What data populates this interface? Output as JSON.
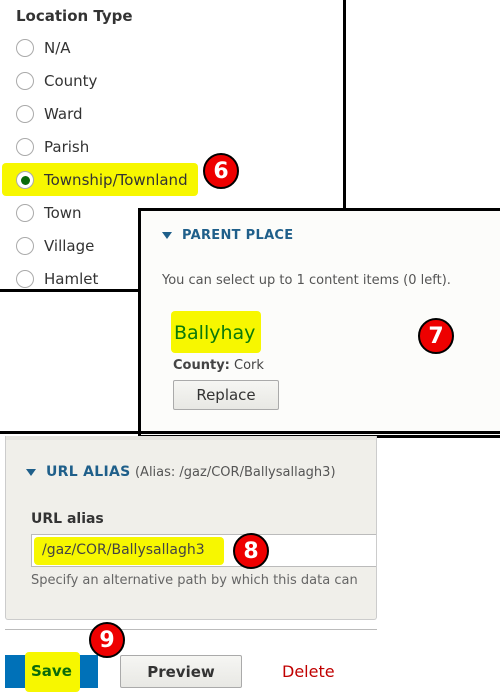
{
  "location_type": {
    "label": "Location Type",
    "options": [
      "N/A",
      "County",
      "Ward",
      "Parish",
      "Township/Townland",
      "Town",
      "Village",
      "Hamlet"
    ],
    "selected": "Township/Townland"
  },
  "parent_place": {
    "header": "PARENT PLACE",
    "hint": "You can select up to 1 content items (0 left).",
    "item_title": "Ballyhay",
    "county_label": "County:",
    "county_value": "Cork",
    "replace_label": "Replace"
  },
  "url_alias": {
    "header": "URL ALIAS",
    "summary": "(Alias: /gaz/COR/Ballysallagh3)",
    "field_label": "URL alias",
    "value": "/gaz/COR/Ballysallagh3",
    "description": "Specify an alternative path by which this data can"
  },
  "actions": {
    "save": "Save",
    "preview": "Preview",
    "delete": "Delete"
  },
  "badges": {
    "b6": "6",
    "b7": "7",
    "b8": "8",
    "b9": "9"
  },
  "colors": {
    "highlight": "#f7f700",
    "badge": "#e00000",
    "primary": "#0071b8",
    "delete": "#c00000",
    "link": "#1f5f8a"
  }
}
